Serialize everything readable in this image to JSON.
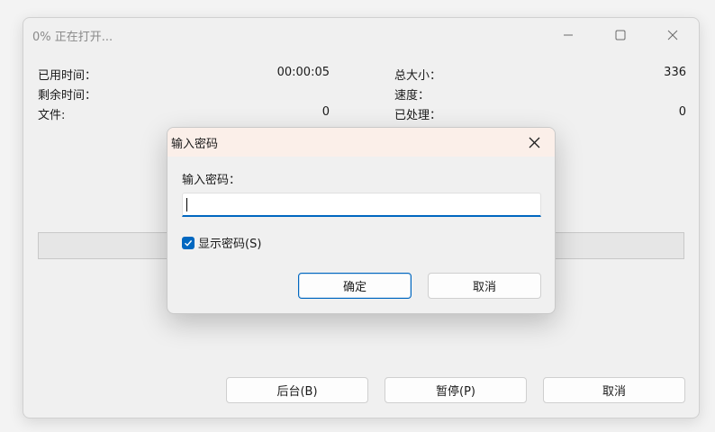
{
  "main": {
    "title": "0% 正在打开...",
    "stats_left": [
      {
        "label": "已用时间：",
        "value": "00:00:05"
      },
      {
        "label": "剩余时间：",
        "value": ""
      },
      {
        "label": "文件:",
        "value": "0"
      }
    ],
    "stats_right": [
      {
        "label": "总大小：",
        "value": "336"
      },
      {
        "label": "速度：",
        "value": ""
      },
      {
        "label": "已处理：",
        "value": "0"
      }
    ],
    "progress": 0,
    "buttons": {
      "background": "后台(B)",
      "pause": "暂停(P)",
      "cancel": "取消"
    }
  },
  "dialog": {
    "title": "输入密码",
    "label": "输入密码：",
    "password_value": "",
    "show_password_label": "显示密码(S)",
    "show_password_checked": true,
    "ok_label": "确定",
    "cancel_label": "取消"
  },
  "colors": {
    "accent": "#0067c0",
    "dialog_titlebar": "#fbefe9"
  }
}
